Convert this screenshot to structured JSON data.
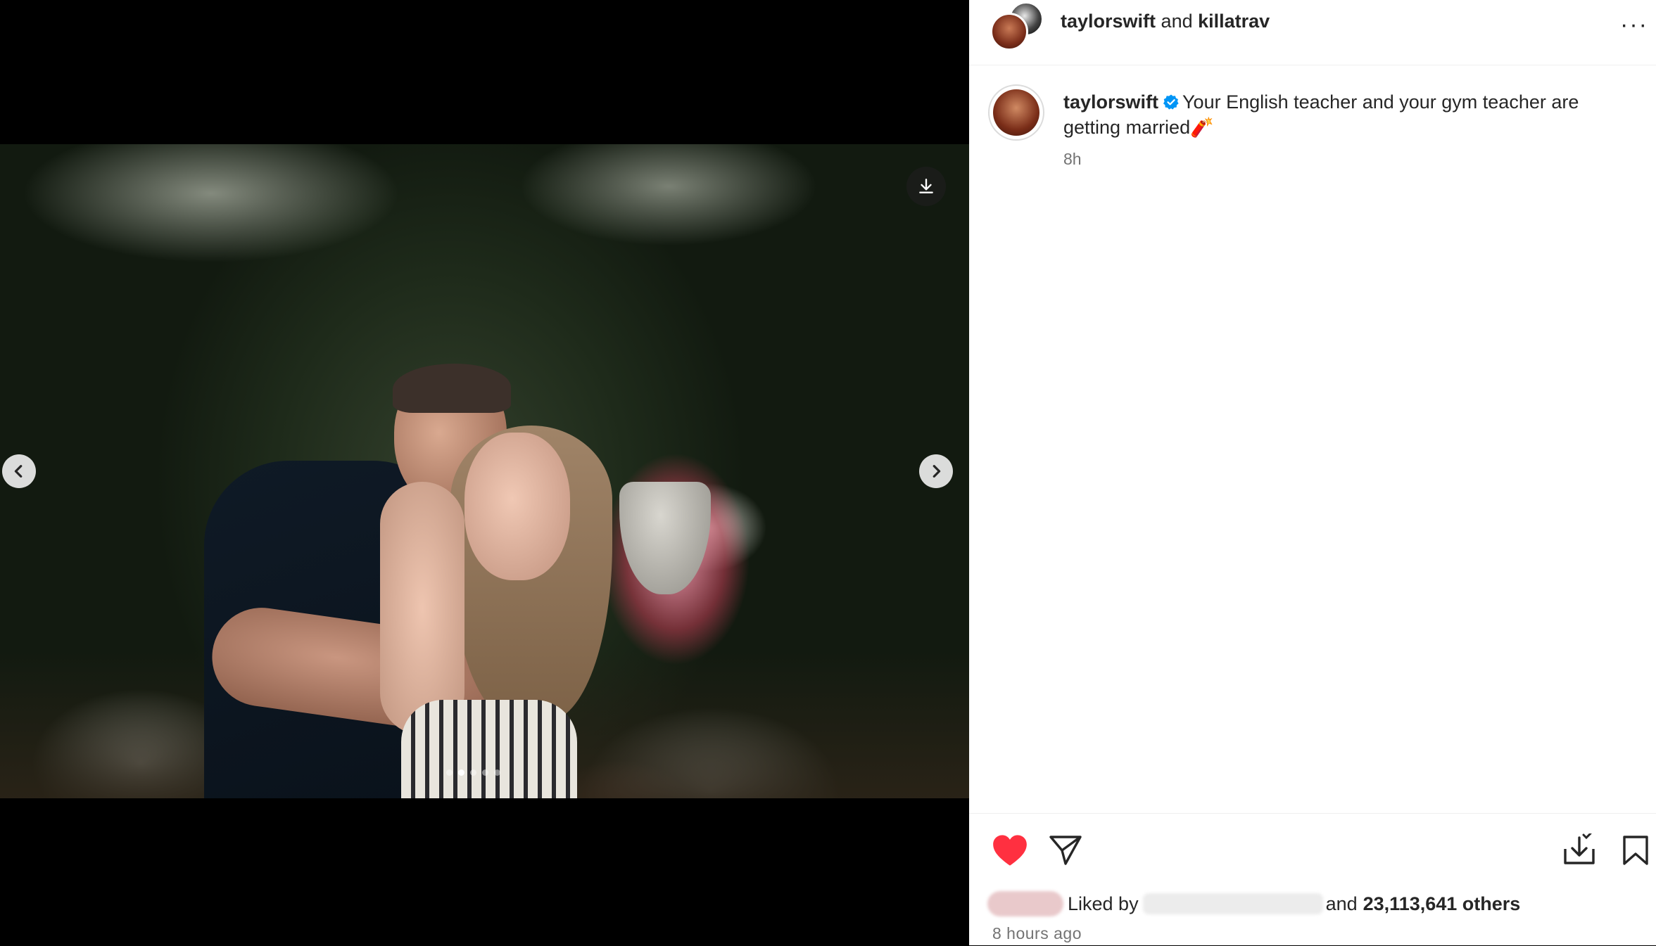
{
  "post_header": {
    "author_primary": "taylorswift",
    "connector": "and",
    "author_secondary": "killatrav",
    "more_icon": "more-horizontal-icon"
  },
  "caption": {
    "username": "taylorswift",
    "verified_icon": "verified-badge-icon",
    "text_line1": "Your English teacher and your gym teacher are",
    "text_line2": "getting married",
    "emoji": "🧨",
    "timestamp": "8h"
  },
  "media": {
    "prev_icon": "chevron-left-icon",
    "next_icon": "chevron-right-icon",
    "download_icon": "download-icon",
    "carousel": {
      "count": 5,
      "active": 2
    }
  },
  "actions": {
    "like_icon": "heart-filled-icon",
    "share_icon": "send-icon",
    "save_to_icon": "download-tray-icon",
    "bookmark_icon": "bookmark-icon",
    "like_color": "#ff3040"
  },
  "likes": {
    "prefix": "Liked by",
    "connector": "and",
    "count_text": "23,113,641 others",
    "time_ago": "8 hours ago"
  }
}
